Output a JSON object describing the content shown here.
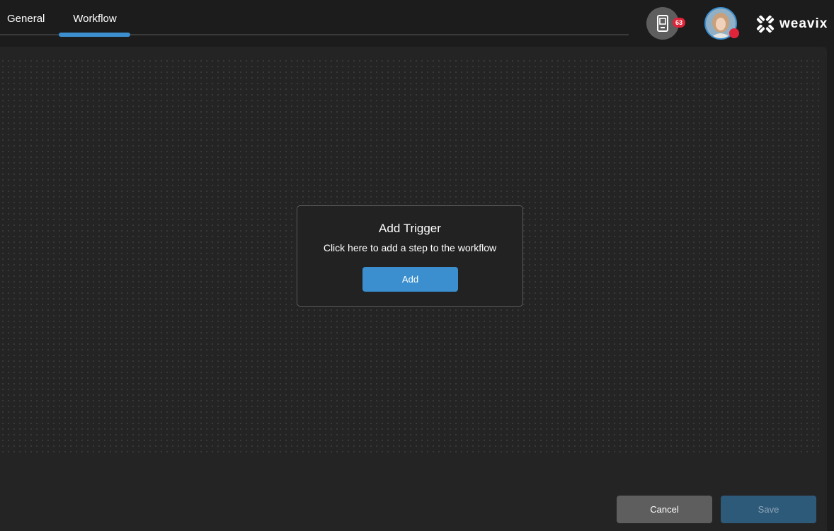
{
  "tabs": [
    {
      "label": "General",
      "active": false
    },
    {
      "label": "Workflow",
      "active": true
    }
  ],
  "header": {
    "device_badge_count": "63",
    "brand_name": "weavix",
    "avatar_status_color": "#e0253a"
  },
  "trigger": {
    "title": "Add Trigger",
    "subtitle": "Click here to add a step to the workflow",
    "add_label": "Add"
  },
  "footer": {
    "cancel_label": "Cancel",
    "save_label": "Save"
  },
  "colors": {
    "accent": "#3b8fcf",
    "badge": "#e0253a",
    "background": "#1c1c1c"
  }
}
